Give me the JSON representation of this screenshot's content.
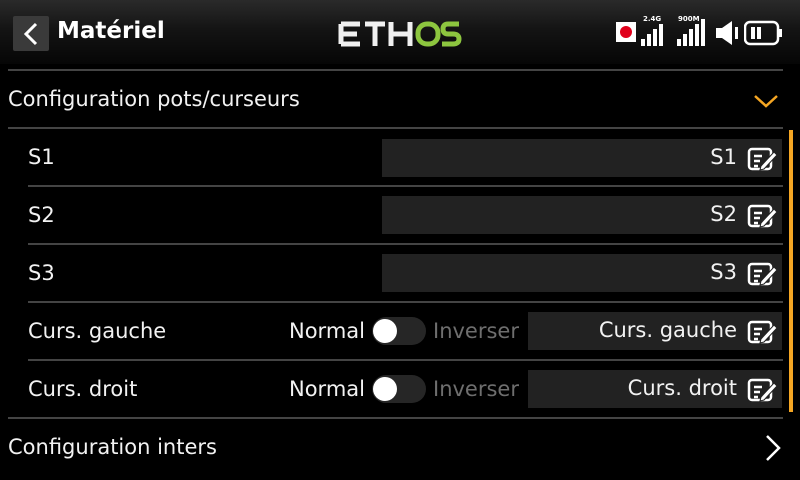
{
  "header": {
    "title": "Matériel",
    "logo_text": "ETHOS",
    "status": {
      "label_24g": "2.4G",
      "label_900m": "900M"
    }
  },
  "sections": {
    "pots": {
      "title": "Configuration pots/curseurs",
      "expanded": true
    },
    "inters": {
      "title": "Configuration inters",
      "expanded": false
    }
  },
  "rows": [
    {
      "label": "S1",
      "value": "S1"
    },
    {
      "label": "S2",
      "value": "S2"
    },
    {
      "label": "S3",
      "value": "S3"
    },
    {
      "label": "Curs. gauche",
      "normal": "Normal",
      "inverse": "Inverser",
      "inverted": false,
      "value": "Curs. gauche"
    },
    {
      "label": "Curs. droit",
      "normal": "Normal",
      "inverse": "Inverser",
      "inverted": false,
      "value": "Curs. droit"
    }
  ],
  "colors": {
    "accent": "#f5a623",
    "logo_green": "#8dc63f",
    "record": "#e0001b"
  }
}
